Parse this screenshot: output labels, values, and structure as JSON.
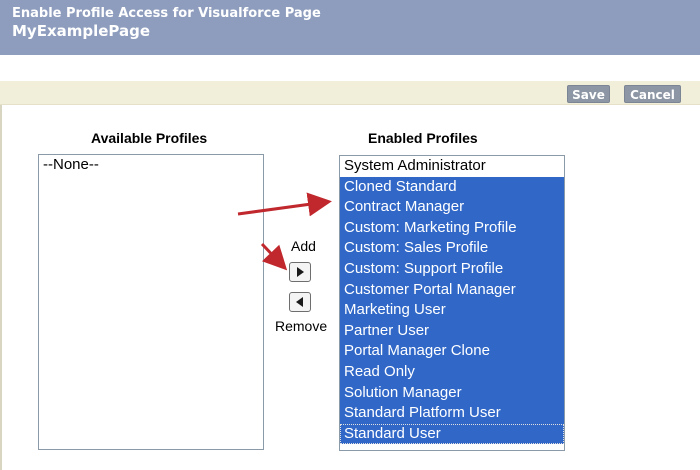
{
  "header": {
    "subtitle": "Enable Profile Access for Visualforce Page",
    "title": "MyExamplePage"
  },
  "toolbar": {
    "save_label": "Save",
    "cancel_label": "Cancel"
  },
  "available": {
    "label": "Available Profiles",
    "items": [
      "--None--"
    ]
  },
  "enabled": {
    "label": "Enabled Profiles",
    "items": [
      "System Administrator",
      "Cloned Standard",
      "Contract Manager",
      "Custom: Marketing Profile",
      "Custom: Sales Profile",
      "Custom: Support Profile",
      "Customer Portal Manager",
      "Marketing User",
      "Partner User",
      "Portal Manager Clone",
      "Read Only",
      "Solution Manager",
      "Standard Platform User",
      "Standard User"
    ]
  },
  "controls": {
    "add_label": "Add",
    "remove_label": "Remove",
    "add_icon": "triangle-right-icon",
    "remove_icon": "triangle-left-icon"
  },
  "colors": {
    "header_bg": "#8e9dbe",
    "selection": "#3168c8",
    "annotation_arrow": "#c0282d"
  }
}
